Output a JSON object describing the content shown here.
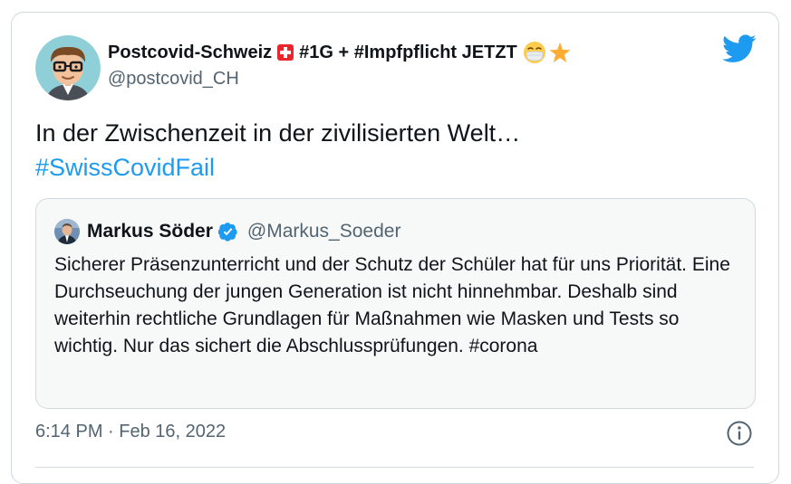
{
  "author": {
    "display_name": "Postcovid-Schweiz",
    "tags": "#1G + #Impfpflicht JETZT",
    "handle": "@postcovid_CH",
    "emojis": [
      "swiss-flag",
      "face-with-medical-mask",
      "star"
    ]
  },
  "tweet": {
    "text": "In der Zwischenzeit in der zivilisierten Welt…",
    "hashtag": "#SwissCovidFail"
  },
  "quote": {
    "display_name": "Markus Söder",
    "handle": "@Markus_Soeder",
    "verified": true,
    "text": "Sicherer Präsenzunterricht und der Schutz der Schüler hat für uns Priorität. Eine Durchseuchung der jungen Generation ist nicht hinnehmbar. Deshalb sind weiterhin rechtliche Grundlagen für Maßnahmen wie Masken und Tests so wichtig. Nur das sichert die Abschlussprüfungen. #corona"
  },
  "meta": {
    "timestamp": "6:14 PM · Feb 16, 2022"
  },
  "colors": {
    "accent": "#1d9bf0",
    "text": "#0f1419",
    "secondary": "#536471",
    "border": "#cfd9de",
    "quote_bg": "#f7f9f9"
  }
}
